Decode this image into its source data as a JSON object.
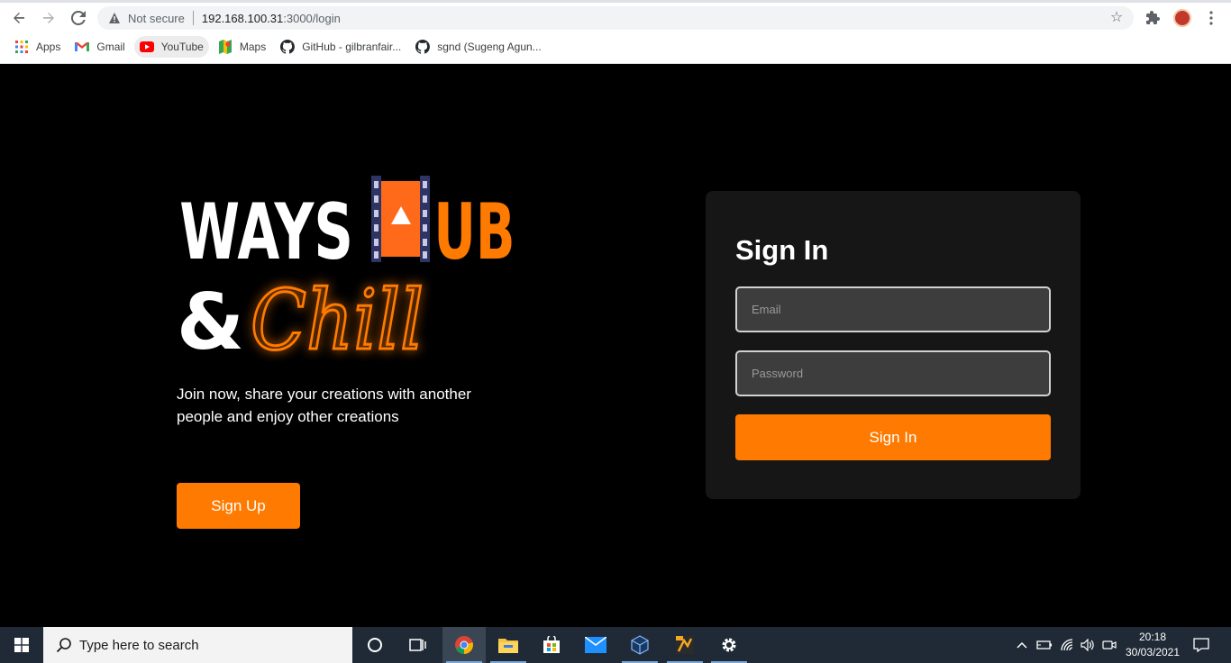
{
  "browser": {
    "security_label": "Not secure",
    "url_host": "192.168.100.31",
    "url_path": ":3000/login",
    "bookmarks": [
      {
        "label": "Apps",
        "icon": "apps-grid-icon"
      },
      {
        "label": "Gmail",
        "icon": "gmail-icon"
      },
      {
        "label": "YouTube",
        "icon": "youtube-icon"
      },
      {
        "label": "Maps",
        "icon": "maps-icon"
      },
      {
        "label": "GitHub - gilbranfair...",
        "icon": "github-icon"
      },
      {
        "label": "sgnd (Sugeng Agun...",
        "icon": "github-icon"
      }
    ]
  },
  "hero": {
    "logo_word1": "WAYS",
    "logo_word2": "UB",
    "logo_amp": "&",
    "logo_script": "Chill",
    "tagline": "Join now, share your creations with another people and enjoy other creations",
    "signup_label": "Sign Up"
  },
  "signin": {
    "title": "Sign In",
    "email_placeholder": "Email",
    "password_placeholder": "Password",
    "submit_label": "Sign In"
  },
  "taskbar": {
    "search_placeholder": "Type here to search",
    "time": "20:18",
    "date": "30/03/2021"
  },
  "colors": {
    "accent": "#ff7a00",
    "card": "#161616",
    "page_bg": "#000000",
    "taskbar": "#1f2a36"
  }
}
